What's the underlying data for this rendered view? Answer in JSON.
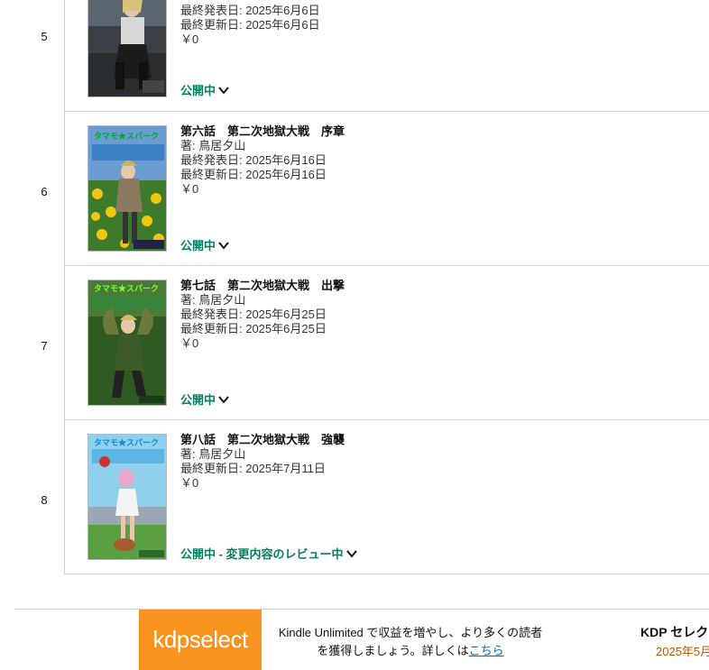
{
  "books": [
    {
      "index": "5",
      "title": "",
      "author": "",
      "published": "最終発表日: 2025年6月6日",
      "updated": "最終更新日: 2025年6月6日",
      "price": "￥0",
      "status": "公開中"
    },
    {
      "index": "6",
      "title": "第六話　第二次地獄大戦　序章",
      "author": "著: 鳥居夕山",
      "published": "最終発表日: 2025年6月16日",
      "updated": "最終更新日: 2025年6月16日",
      "price": "￥0",
      "status": "公開中"
    },
    {
      "index": "7",
      "title": "第七話　第二次地獄大戦　出撃",
      "author": "著: 鳥居夕山",
      "published": "最終発表日: 2025年6月25日",
      "updated": "最終更新日: 2025年6月25日",
      "price": "￥0",
      "status": "公開中"
    },
    {
      "index": "8",
      "title": "第八話　第二次地獄大戦　強襲",
      "author": "著: 鳥居夕山",
      "published": "",
      "updated": "最終更新日: 2025年7月11日",
      "price": "￥0",
      "status": "公開中 - 変更内容のレビュー中"
    }
  ],
  "footer": {
    "logo_kdp": "kdp",
    "logo_select": "select",
    "promo_line1": "Kindle Unlimited で収益を増やし、より多くの読者",
    "promo_line2": "を獲得しましょう。詳しくは",
    "promo_link": "こちら",
    "side_title": "KDP セレク",
    "side_date": "2025年5月"
  },
  "colors": {
    "status_green": "#067d62",
    "kdp_orange": "#f7931e",
    "link_blue": "#0066c0",
    "date_orange": "#c45500"
  }
}
